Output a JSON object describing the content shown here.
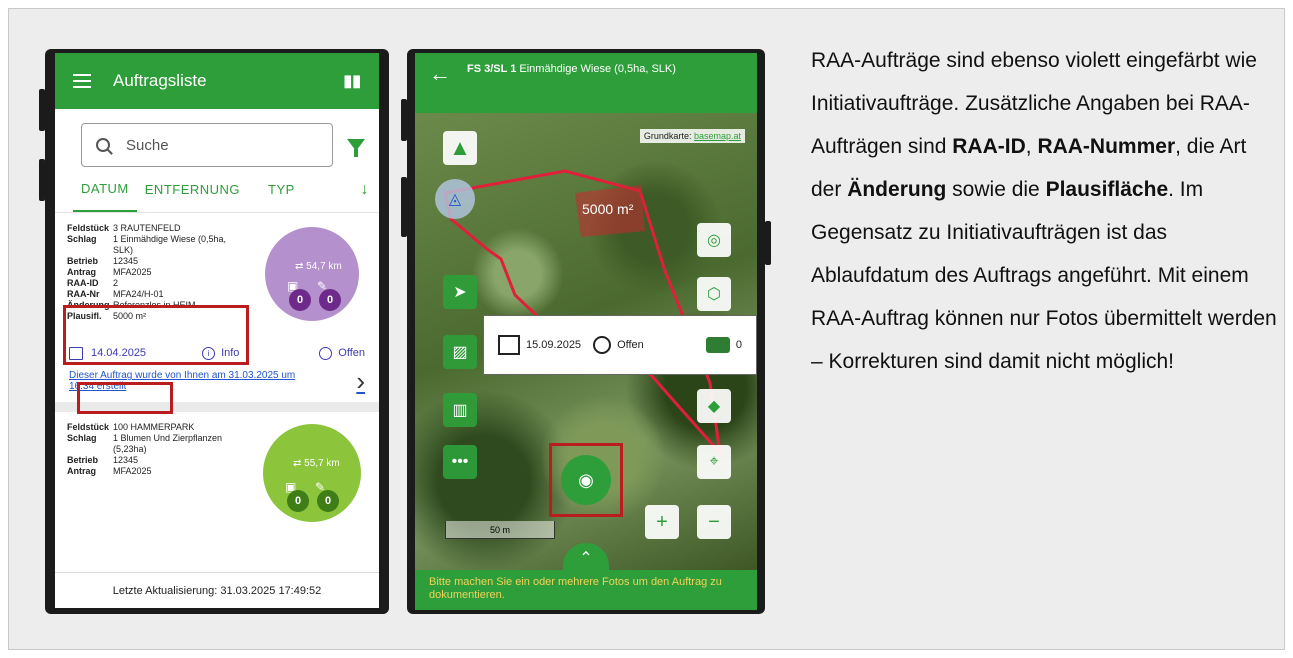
{
  "list_screen": {
    "title": "Auftragsliste",
    "search_placeholder": "Suche",
    "tabs": [
      "DATUM",
      "ENTFERNUNG",
      "TYP"
    ],
    "card1": {
      "rows": [
        {
          "k": "Feldstück",
          "v": "3 RAUTENFELD"
        },
        {
          "k": "Schlag",
          "v": "1 Einmähdige Wiese (0,5ha, SLK)"
        },
        {
          "k": "Betrieb",
          "v": "12345"
        },
        {
          "k": "Antrag",
          "v": "MFA2025"
        },
        {
          "k": "RAA-ID",
          "v": "2"
        },
        {
          "k": "RAA-Nr",
          "v": "MFA24/H-01"
        },
        {
          "k": "Änderung",
          "v": "Referenzlos in HEIM"
        },
        {
          "k": "Plausifl.",
          "v": "5000 m²"
        }
      ],
      "distance": "54,7 km",
      "photo_count": "0",
      "edit_count": "0",
      "date": "14.04.2025",
      "info": "Info",
      "status": "Offen",
      "created": "Dieser Auftrag wurde von Ihnen am 31.03.2025 um 16:34 erstellt"
    },
    "card2": {
      "rows": [
        {
          "k": "Feldstück",
          "v": "100 HAMMERPARK"
        },
        {
          "k": "Schlag",
          "v": "1 Blumen Und Zierpflanzen (5,23ha)"
        },
        {
          "k": "Betrieb",
          "v": "12345"
        },
        {
          "k": "Antrag",
          "v": "MFA2025"
        }
      ],
      "distance": "55,7 km",
      "photo_count": "0",
      "edit_count": "0"
    },
    "footer": "Letzte Aktualisierung: 31.03.2025 17:49:52",
    "colors": {
      "green": "#2e9e3a",
      "violet": "#b490cc",
      "lightgreen": "#8cc43c",
      "highlight": "#b91d1d"
    }
  },
  "map_screen": {
    "title_bold": "FS 3/SL 1",
    "title_rest": " Einmähdige Wiese (0,5ha, SLK)",
    "basemap_label": "Grundkarte:",
    "basemap_link": "basemap.at",
    "area": "5000 m²",
    "info_date": "15.09.2025",
    "info_status": "Offen",
    "layer_count": "0",
    "scale": "50 m",
    "bottom_message": "Bitte machen Sie ein oder mehrere Fotos um den Auftrag zu dokumentieren."
  },
  "description": {
    "t1": "RAA-Aufträge sind ebenso violett eingefärbt wie Initiativaufträge. Zusätzliche Angaben bei RAA-Aufträgen sind ",
    "b1": "RAA-ID",
    "t2": ", ",
    "b2": "RAA-Nummer",
    "t3": ", die Art der ",
    "b3": "Änderung",
    "t4": " sowie die ",
    "b4": "Plausifläche",
    "t5": ". Im Gegensatz zu Initiativaufträgen ist das Ablaufdatum des Auftrags angeführt. Mit einem RAA-Auftrag können nur Fotos übermittelt werden – Korrekturen sind damit nicht möglich!"
  }
}
